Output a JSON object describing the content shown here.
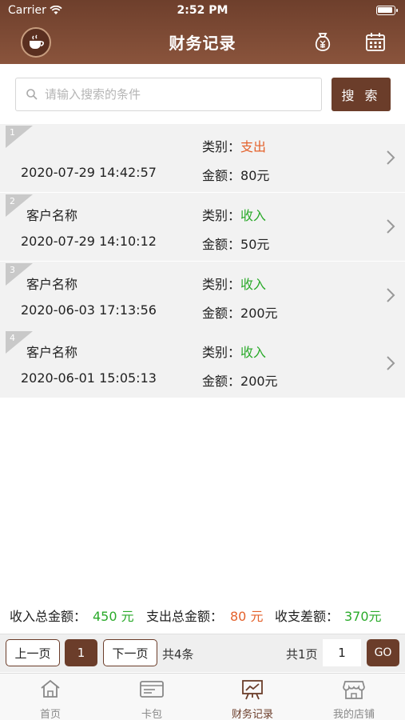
{
  "status_bar": {
    "carrier": "Carrier",
    "time": "2:52 PM"
  },
  "header": {
    "title": "财务记录",
    "left_icon": "coffee-cup-icon",
    "right_icons": [
      "money-bag-icon",
      "calendar-icon"
    ]
  },
  "search": {
    "placeholder": "请输入搜索的条件",
    "value": "",
    "button_label": "搜 索"
  },
  "records": [
    {
      "index": "1",
      "customer": "",
      "datetime": "2020-07-29 14:42:57",
      "category_label": "类别：",
      "category": "支出",
      "category_type": "expense",
      "amount_label": "金额：",
      "amount": "80元"
    },
    {
      "index": "2",
      "customer": "客户名称",
      "datetime": "2020-07-29 14:10:12",
      "category_label": "类别：",
      "category": "收入",
      "category_type": "income",
      "amount_label": "金额：",
      "amount": "50元"
    },
    {
      "index": "3",
      "customer": "客户名称",
      "datetime": "2020-06-03 17:13:56",
      "category_label": "类别：",
      "category": "收入",
      "category_type": "income",
      "amount_label": "金额：",
      "amount": "200元"
    },
    {
      "index": "4",
      "customer": "客户名称",
      "datetime": "2020-06-01 15:05:13",
      "category_label": "类别：",
      "category": "收入",
      "category_type": "income",
      "amount_label": "金额：",
      "amount": "200元"
    }
  ],
  "totals": {
    "income_label": "收入总金额：",
    "income_value": "450 元",
    "expense_label": "支出总金额：",
    "expense_value": "80 元",
    "diff_label": "收支差额：",
    "diff_value": "370元"
  },
  "pager": {
    "prev_label": "上一页",
    "current_page": "1",
    "next_label": "下一页",
    "total_items": "共4条",
    "total_pages": "共1页",
    "goto_value": "1",
    "go_label": "GO"
  },
  "tabs": [
    {
      "label": "首页",
      "icon": "home-icon",
      "active": false
    },
    {
      "label": "卡包",
      "icon": "card-icon",
      "active": false
    },
    {
      "label": "财务记录",
      "icon": "chart-board-icon",
      "active": true
    },
    {
      "label": "我的店铺",
      "icon": "shop-icon",
      "active": false
    }
  ],
  "colors": {
    "brand": "#6b3d2a",
    "income": "#2aaa2a",
    "expense": "#e4612b"
  }
}
